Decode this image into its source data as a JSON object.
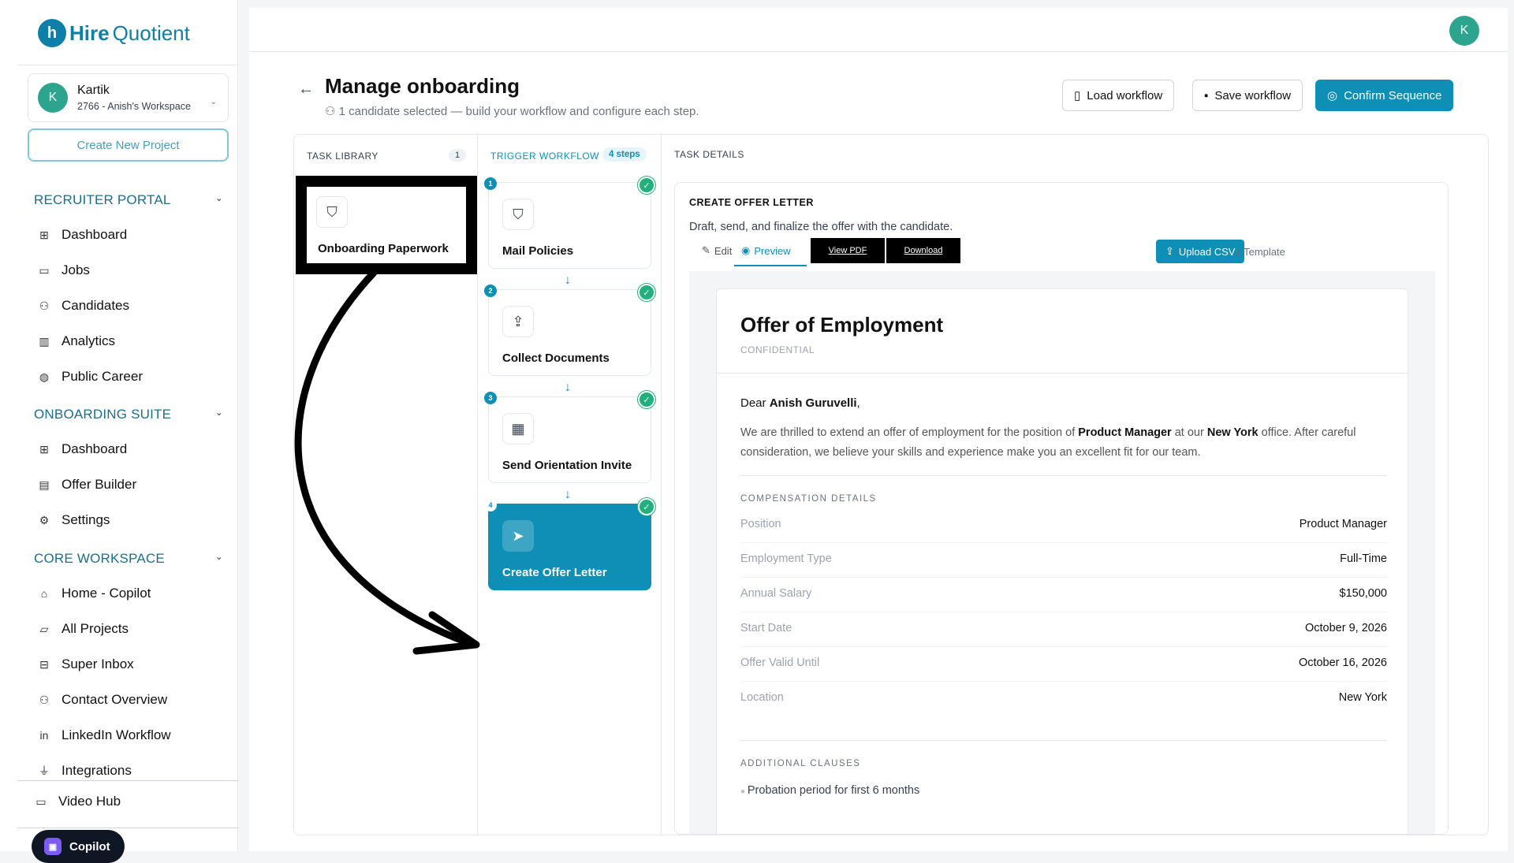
{
  "brand": {
    "name_bold": "Hire",
    "name_light": "Quotient",
    "mark": "h"
  },
  "workspace": {
    "avatar": "K",
    "user": "Kartik",
    "name": "2766 - Anish's Workspace"
  },
  "create_project_label": "Create New Project",
  "sections": {
    "recruiter": {
      "title": "RECRUITER PORTAL",
      "items": [
        "Dashboard",
        "Jobs",
        "Candidates",
        "Analytics",
        "Public Career"
      ]
    },
    "onboarding": {
      "title": "ONBOARDING SUITE",
      "items": [
        "Dashboard",
        "Offer Builder",
        "Settings"
      ]
    },
    "core": {
      "title": "CORE WORKSPACE",
      "items": [
        "Home - Copilot",
        "All Projects",
        "Super Inbox",
        "Contact Overview",
        "LinkedIn Workflow",
        "Integrations"
      ]
    }
  },
  "video_hub": "Video Hub",
  "copilot_label": "Copilot",
  "topbar_avatar": "K",
  "page": {
    "title": "Manage onboarding",
    "subtitle": "1 candidate selected — build your workflow and configure each step."
  },
  "buttons": {
    "load": "Load workflow",
    "save": "Save workflow",
    "confirm": "Confirm Sequence"
  },
  "task_library": {
    "header": "TASK LIBRARY",
    "count": "1",
    "items": [
      "Onboarding Paperwork"
    ]
  },
  "trigger": {
    "header": "TRIGGER WORKFLOW",
    "steps_badge": "4 steps",
    "steps": [
      {
        "num": "1",
        "label": "Mail Policies",
        "icon": "shield-icon"
      },
      {
        "num": "2",
        "label": "Collect Documents",
        "icon": "upload-icon"
      },
      {
        "num": "3",
        "label": "Send Orientation Invite",
        "icon": "calendar-icon"
      },
      {
        "num": "4",
        "label": "Create Offer Letter",
        "icon": "send-icon"
      }
    ]
  },
  "task_details": {
    "header": "TASK DETAILS",
    "card_title": "CREATE OFFER LETTER",
    "description": "Draft, send, and finalize the offer with the candidate.",
    "tabs": {
      "edit": "Edit",
      "preview": "Preview",
      "view_pdf": "View PDF",
      "download": "Download"
    },
    "upload_csv": "Upload CSV",
    "template": "Template"
  },
  "offer": {
    "title": "Offer of Employment",
    "confidential": "CONFIDENTIAL",
    "dear": "Dear",
    "candidate": "Anish Guruvelli",
    "para1": "We are thrilled to extend an offer of employment for the position of",
    "position_bold": "Product Manager",
    "para2": "at our",
    "office_bold": "New York",
    "para3": "office. After careful consideration, we believe your skills and experience make you an excellent fit for our team.",
    "comp_header": "COMPENSATION DETAILS",
    "comp_rows": [
      {
        "k": "Position",
        "v": "Product Manager"
      },
      {
        "k": "Employment Type",
        "v": "Full-Time"
      },
      {
        "k": "Annual Salary",
        "v": "$150,000"
      },
      {
        "k": "Start Date",
        "v": "October 9, 2026"
      },
      {
        "k": "Offer Valid Until",
        "v": "October 16, 2026"
      },
      {
        "k": "Location",
        "v": "New York"
      }
    ],
    "clauses_header": "ADDITIONAL CLAUSES",
    "clause1": "Probation period for first 6 months"
  },
  "colors": {
    "accent": "#0e8fb6",
    "success": "#22b07d"
  }
}
